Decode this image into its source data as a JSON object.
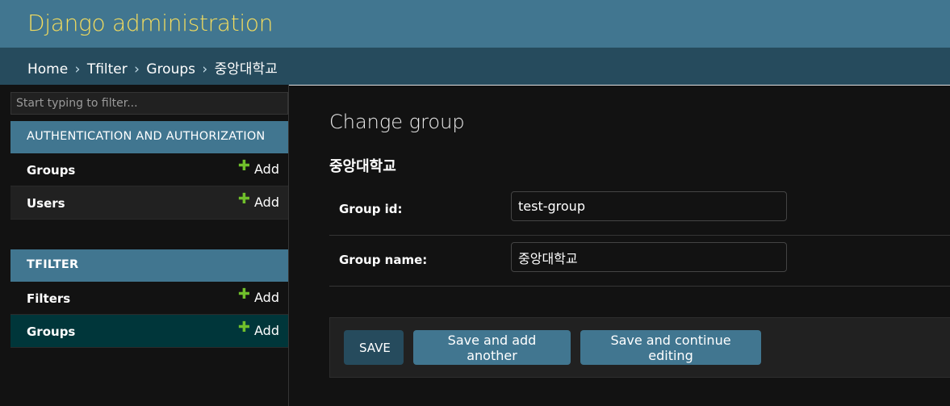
{
  "header": {
    "branding": "Django administration"
  },
  "breadcrumbs": [
    {
      "label": "Home"
    },
    {
      "label": "Tfilter"
    },
    {
      "label": "Groups"
    },
    {
      "label": "중앙대학교"
    }
  ],
  "breadcrumb_separator": "›",
  "sidebar": {
    "filter_placeholder": "Start typing to filter...",
    "apps": [
      {
        "caption": "AUTHENTICATION AND AUTHORIZATION",
        "models": [
          {
            "label": "Groups",
            "add": "Add"
          },
          {
            "label": "Users",
            "add": "Add"
          }
        ]
      },
      {
        "caption": "TFILTER",
        "models": [
          {
            "label": "Filters",
            "add": "Add"
          },
          {
            "label": "Groups",
            "add": "Add",
            "current": true
          }
        ]
      }
    ],
    "add_icon": "plus-icon"
  },
  "content": {
    "title": "Change group",
    "object_name": "중앙대학교",
    "fields": [
      {
        "label": "Group id:",
        "value": "test-group"
      },
      {
        "label": "Group name:",
        "value": "중앙대학교"
      }
    ],
    "buttons": {
      "save": "SAVE",
      "save_add_another": "Save and add another",
      "save_continue": "Save and continue editing"
    }
  },
  "colors": {
    "header_bg": "#417690",
    "branding": "#f5dd5d",
    "breadcrumbs_bg": "#264b5d",
    "caption_bg": "#417690",
    "current_model_bg": "#00363a",
    "add_icon": "#70bf2b",
    "default_button": "#264b5d",
    "button": "#417690"
  }
}
